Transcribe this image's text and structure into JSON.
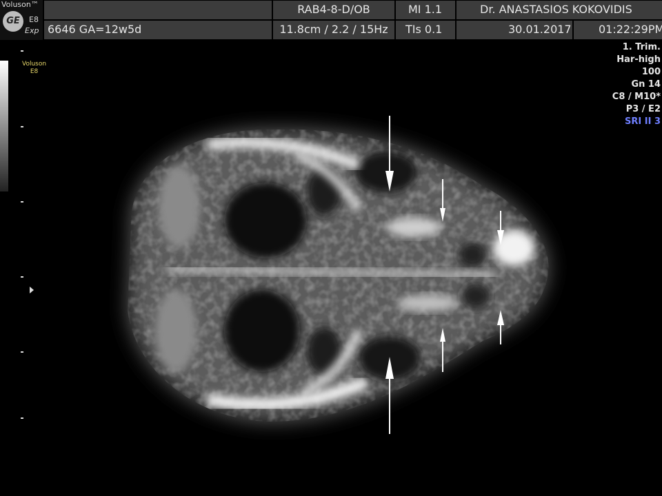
{
  "header": {
    "brand": "Voluson™",
    "logo_text": "GE",
    "model": "E8",
    "edition": "Exp",
    "probe": "RAB4-8-D/OB",
    "mi": "MI  1.1",
    "doctor": "Dr. ANASTASIOS KOKOVIDIS",
    "patient_info": "6646  GA=12w5d",
    "depth_freq": "11.8cm / 2.2 / 15Hz",
    "tis": "TIs  0.1",
    "date": "30.01.2017",
    "time": "01:22:29PM"
  },
  "left": {
    "brand_small": "Voluson",
    "model_small": "E8"
  },
  "params": {
    "trimester": "1. Trim.",
    "harmonic": "Har-high",
    "value": "100",
    "gain": "Gn  14",
    "cm": "C8 / M10*",
    "pe": "P3 / E2",
    "sri": "SRI II 3"
  },
  "colors": {
    "header_cell": "#3c3c3c",
    "sri_text": "#6f7fff",
    "brand_yellow": "#e8d86a"
  },
  "icons": [
    "ge-logo-icon",
    "arrow-down-icon",
    "arrow-up-icon",
    "depth-marker-icon"
  ]
}
